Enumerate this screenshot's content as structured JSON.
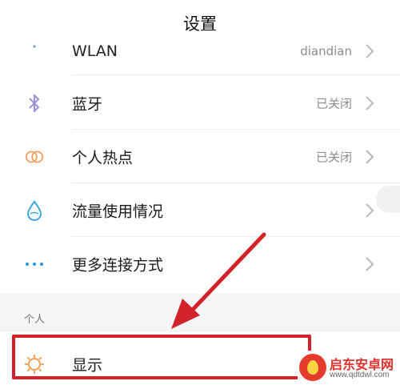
{
  "header": {
    "title": "设置"
  },
  "rows": {
    "wlan": {
      "label": "WLAN",
      "value": "diandian",
      "icon": "wifi-icon"
    },
    "bluetooth": {
      "label": "蓝牙",
      "value": "已关闭",
      "icon": "bluetooth-icon"
    },
    "hotspot": {
      "label": "个人热点",
      "value": "已关闭",
      "icon": "hotspot-icon"
    },
    "data": {
      "label": "流量使用情况",
      "icon": "water-drop-icon"
    },
    "more": {
      "label": "更多连接方式",
      "icon": "more-dots-icon"
    },
    "display": {
      "label": "显示",
      "icon": "sun-icon"
    }
  },
  "section": {
    "personal": "个人"
  },
  "watermark": {
    "name": "启东安卓网",
    "url": "www.qdtdwl.com"
  },
  "colors": {
    "highlight": "#d3232a",
    "bluetooth": "#9b8fd8",
    "hotspot": "#f0a060",
    "data": "#3aa8e0",
    "more": "#2a9be0",
    "display": "#f0a050"
  }
}
